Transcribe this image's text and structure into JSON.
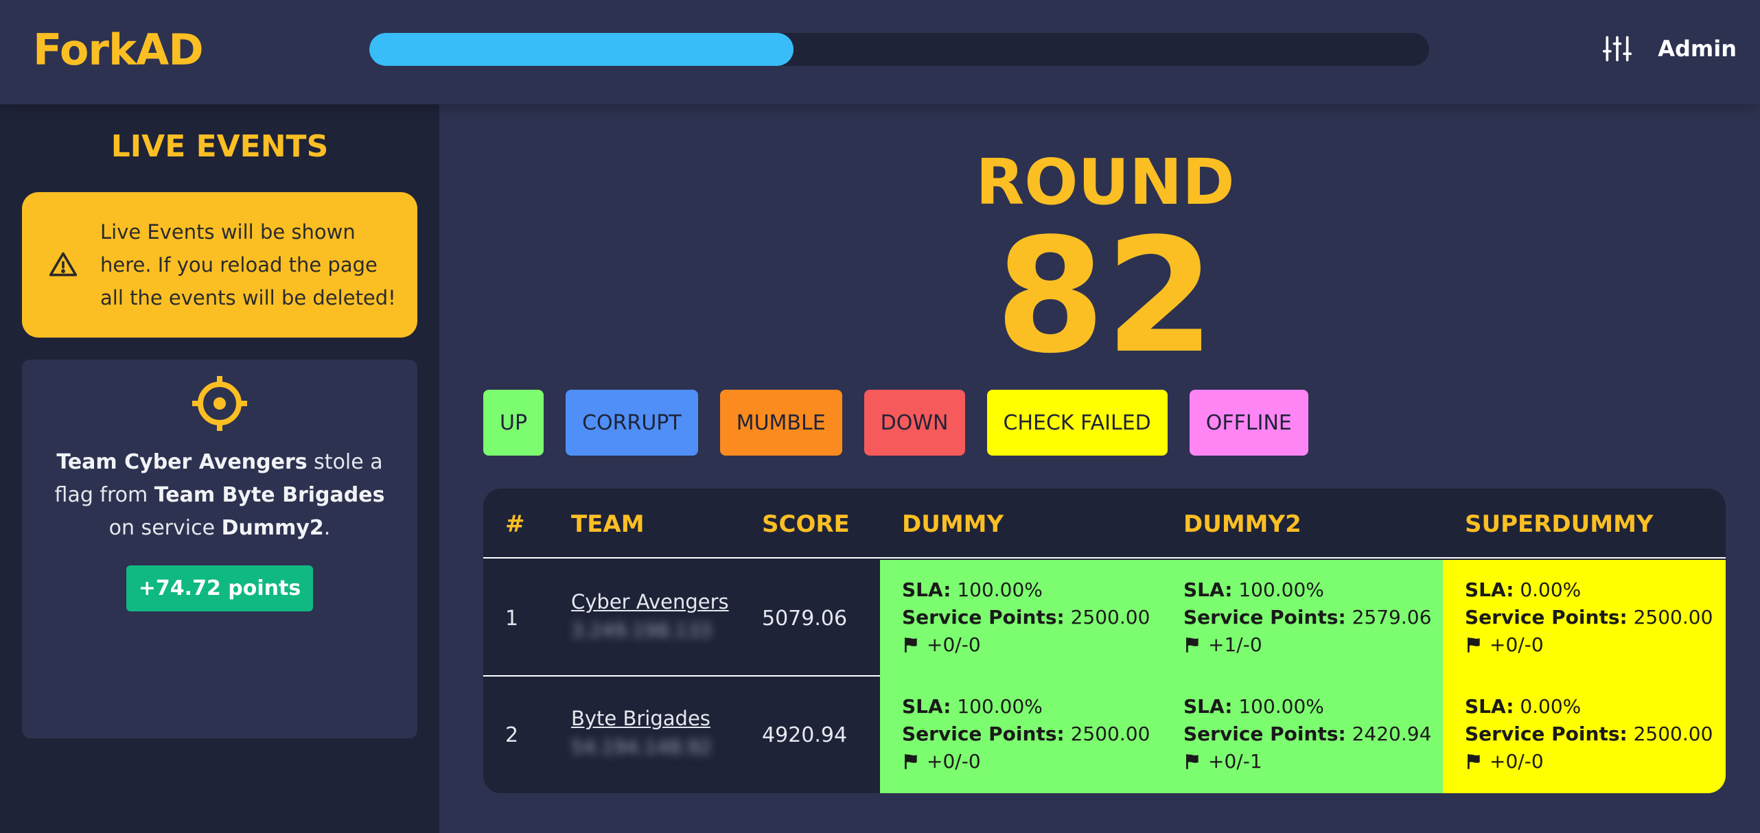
{
  "app": {
    "logo": "ForkAD",
    "admin_label": "Admin",
    "round_progress": 0.4,
    "progress_color": "#38bdf8"
  },
  "sidebar": {
    "title": "LIVE EVENTS",
    "notice": "Live Events will be shown here. If you reload the page all the events will be deleted!",
    "event": {
      "prefix_team_label": "Team Cyber Avengers",
      "stole_text": " stole a flag from ",
      "victim_team_label": "Team Byte Brigades",
      "service_text": " on service ",
      "service_name": "Dummy2",
      "suffix": ".",
      "points": "+74.72 points"
    }
  },
  "round": {
    "title": "ROUND",
    "number": "82"
  },
  "legend": [
    {
      "label": "UP",
      "color": "#7cfc6f"
    },
    {
      "label": "CORRUPT",
      "color": "#4f8ff7"
    },
    {
      "label": "MUMBLE",
      "color": "#fb8b1e"
    },
    {
      "label": "DOWN",
      "color": "#f75a5a"
    },
    {
      "label": "CHECK FAILED",
      "color": "#ffff00"
    },
    {
      "label": "OFFLINE",
      "color": "#ff85f5"
    }
  ],
  "table": {
    "headers": [
      "#",
      "TEAM",
      "SCORE",
      "DUMMY",
      "DUMMY2",
      "SUPERDUMMY"
    ],
    "sla_label": "SLA:",
    "points_label": "Service Points:",
    "rows": [
      {
        "rank": "1",
        "team": "Cyber Avengers",
        "ip": "3.249.198.133",
        "score": "5079.06",
        "services": [
          {
            "sla": "100.00%",
            "points": "2500.00",
            "flags": "+0/-0",
            "status_color": "#7cfc6f"
          },
          {
            "sla": "100.00%",
            "points": "2579.06",
            "flags": "+1/-0",
            "status_color": "#7cfc6f"
          },
          {
            "sla": "0.00%",
            "points": "2500.00",
            "flags": "+0/-0",
            "status_color": "#ffff00"
          }
        ]
      },
      {
        "rank": "2",
        "team": "Byte Brigades",
        "ip": "54.194.148.92",
        "score": "4920.94",
        "services": [
          {
            "sla": "100.00%",
            "points": "2500.00",
            "flags": "+0/-0",
            "status_color": "#7cfc6f"
          },
          {
            "sla": "100.00%",
            "points": "2420.94",
            "flags": "+0/-1",
            "status_color": "#7cfc6f"
          },
          {
            "sla": "0.00%",
            "points": "2500.00",
            "flags": "+0/-0",
            "status_color": "#ffff00"
          }
        ]
      }
    ]
  }
}
